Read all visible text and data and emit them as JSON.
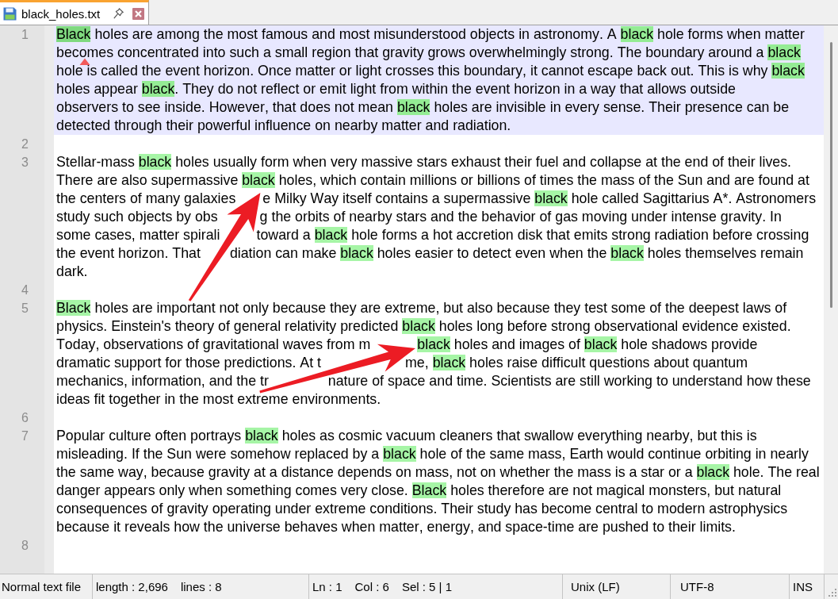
{
  "tab": {
    "title": "black_holes.txt",
    "selected": true
  },
  "editor": {
    "lines": [
      {
        "number": "1",
        "current": true,
        "rows": [
          {
            "segments": [
              {
                "text": "Black",
                "highlighted": true,
                "selected": true
              },
              {
                "text": " holes are among the most famous and most misunderstood objects in astronomy. A ",
                "highlighted": false,
                "selected": false
              },
              {
                "text": "black",
                "highlighted": true,
                "selected": false
              },
              {
                "text": " hole forms when matter",
                "highlighted": false,
                "selected": false
              }
            ]
          },
          {
            "segments": [
              {
                "text": "becomes concentrated into such a small region that gravity grows overwhelmingly strong. The boundary around a ",
                "highlighted": false,
                "selected": false
              },
              {
                "text": "black",
                "highlighted": true,
                "selected": false
              }
            ]
          },
          {
            "segments": [
              {
                "text": "hole is called the event horizon. Once matter or light crosses this boundary, it cannot escape back out. This is why ",
                "highlighted": false,
                "selected": false
              },
              {
                "text": "black",
                "highlighted": true,
                "selected": false
              }
            ]
          },
          {
            "segments": [
              {
                "text": "holes appear ",
                "highlighted": false,
                "selected": false
              },
              {
                "text": "black",
                "highlighted": true,
                "selected": false
              },
              {
                "text": ". They do not reflect or emit light from within the event horizon in a way that allows outside",
                "highlighted": false,
                "selected": false
              }
            ]
          },
          {
            "segments": [
              {
                "text": "observers to see inside. However, that does not mean ",
                "highlighted": false,
                "selected": false
              },
              {
                "text": "black",
                "highlighted": true,
                "selected": false
              },
              {
                "text": " holes are invisible in every sense. Their presence can be",
                "highlighted": false,
                "selected": false
              }
            ]
          },
          {
            "segments": [
              {
                "text": "detected through their powerful influence on nearby matter and radiation.",
                "highlighted": false,
                "selected": false
              }
            ]
          }
        ]
      },
      {
        "number": "2",
        "current": false
      },
      {
        "number": "3",
        "current": false,
        "rows": [
          {
            "segments": [
              {
                "text": "Stellar-mass ",
                "highlighted": false,
                "selected": false
              },
              {
                "text": "black",
                "highlighted": true,
                "selected": false
              },
              {
                "text": " holes usually form when very massive stars exhaust their fuel and collapse at the end of their lives.",
                "highlighted": false,
                "selected": false
              }
            ]
          },
          {
            "segments": [
              {
                "text": "There are also supermassive ",
                "highlighted": false,
                "selected": false
              },
              {
                "text": "black",
                "highlighted": true,
                "selected": false
              },
              {
                "text": " holes, which contain millions or billions of times the mass of the Sun and are found at",
                "highlighted": false,
                "selected": false
              }
            ]
          },
          {
            "segments": [
              {
                "text": "the centers of many galaxies",
                "highlighted": false,
                "selected": false
              },
              {
                "text": "e Milky Way itself contains a supermassive ",
                "highlighted": false,
                "selected": false
              },
              {
                "text": "black",
                "highlighted": true,
                "selected": false
              },
              {
                "text": " hole called Sagittarius A*. Astronomers",
                "highlighted": false,
                "selected": false
              }
            ]
          },
          {
            "segments": [
              {
                "text": "study such objects by obs",
                "highlighted": false,
                "selected": false
              },
              {
                "text": "g the orbits of nearby stars and the behavior of gas moving under intense gravity. In",
                "highlighted": false,
                "selected": false
              }
            ]
          },
          {
            "segments": [
              {
                "text": "some cases, matter spirali",
                "highlighted": false,
                "selected": false
              },
              {
                "text": "toward a ",
                "highlighted": false,
                "selected": false
              },
              {
                "text": "black",
                "highlighted": true,
                "selected": false
              },
              {
                "text": " hole forms a hot accretion disk that emits strong radiation before crossing",
                "highlighted": false,
                "selected": false
              }
            ]
          },
          {
            "segments": [
              {
                "text": "the event horizon. That",
                "highlighted": false,
                "selected": false
              },
              {
                "text": "diation can make ",
                "highlighted": false,
                "selected": false
              },
              {
                "text": "black",
                "highlighted": true,
                "selected": false
              },
              {
                "text": " holes easier to detect even when the ",
                "highlighted": false,
                "selected": false
              },
              {
                "text": "black",
                "highlighted": true,
                "selected": false
              },
              {
                "text": " holes themselves remain",
                "highlighted": false,
                "selected": false
              }
            ]
          },
          {
            "segments": [
              {
                "text": "dark.",
                "highlighted": false,
                "selected": false
              }
            ]
          }
        ]
      },
      {
        "number": "4",
        "current": false
      },
      {
        "number": "5",
        "current": false,
        "rows": [
          {
            "segments": [
              {
                "text": "Black",
                "highlighted": true,
                "selected": false
              },
              {
                "text": " holes are important not only because they are extreme, but also because they test some of the deepest laws of",
                "highlighted": false,
                "selected": false
              }
            ]
          },
          {
            "segments": [
              {
                "text": "physics. Einstein's theory of general relativity predicted ",
                "highlighted": false,
                "selected": false
              },
              {
                "text": "black",
                "highlighted": true,
                "selected": false
              },
              {
                "text": " holes long before strong observational evidence existed.",
                "highlighted": false,
                "selected": false
              }
            ]
          },
          {
            "segments": [
              {
                "text": "Today, observations of gravitational waves from m",
                "highlighted": false,
                "selected": false
              },
              {
                "text": "black",
                "highlighted": true,
                "selected": false
              },
              {
                "text": " holes and images of ",
                "highlighted": false,
                "selected": false
              },
              {
                "text": "black",
                "highlighted": true,
                "selected": false
              },
              {
                "text": " hole shadows provide",
                "highlighted": false,
                "selected": false
              }
            ]
          },
          {
            "segments": [
              {
                "text": "dramatic support for those predictions. At t",
                "highlighted": false,
                "selected": false
              },
              {
                "text": "me, ",
                "highlighted": false,
                "selected": false
              },
              {
                "text": "black",
                "highlighted": true,
                "selected": false
              },
              {
                "text": " holes raise difficult questions about quantum",
                "highlighted": false,
                "selected": false
              }
            ]
          },
          {
            "segments": [
              {
                "text": "mechanics, information, and the tr",
                "highlighted": false,
                "selected": false
              },
              {
                "text": "nature of space and time. Scientists are still working to understand how these",
                "highlighted": false,
                "selected": false
              }
            ]
          },
          {
            "segments": [
              {
                "text": "ideas fit together in the most extreme environments.",
                "highlighted": false,
                "selected": false
              }
            ]
          }
        ]
      },
      {
        "number": "6",
        "current": false
      },
      {
        "number": "7",
        "current": false,
        "rows": [
          {
            "segments": [
              {
                "text": "Popular culture often portrays ",
                "highlighted": false,
                "selected": false
              },
              {
                "text": "black",
                "highlighted": true,
                "selected": false
              },
              {
                "text": " holes as cosmic vacuum cleaners that swallow everything nearby, but this is",
                "highlighted": false,
                "selected": false
              }
            ]
          },
          {
            "segments": [
              {
                "text": "misleading. If the Sun were somehow replaced by a ",
                "highlighted": false,
                "selected": false
              },
              {
                "text": "black",
                "highlighted": true,
                "selected": false
              },
              {
                "text": " hole of the same mass, Earth would continue orbiting in nearly",
                "highlighted": false,
                "selected": false
              }
            ]
          },
          {
            "segments": [
              {
                "text": "the same way, because gravity at a distance depends on mass, not on whether the mass is a star or a ",
                "highlighted": false,
                "selected": false
              },
              {
                "text": "black",
                "highlighted": true,
                "selected": false
              },
              {
                "text": " hole. The real",
                "highlighted": false,
                "selected": false
              }
            ]
          },
          {
            "segments": [
              {
                "text": "danger appears only when something comes very close. ",
                "highlighted": false,
                "selected": false
              },
              {
                "text": "Black",
                "highlighted": true,
                "selected": false
              },
              {
                "text": " holes therefore are not magical monsters, but natural",
                "highlighted": false,
                "selected": false
              }
            ]
          },
          {
            "segments": [
              {
                "text": "consequences of gravity operating under extreme conditions. Their study has become central to modern astrophysics",
                "highlighted": false,
                "selected": false
              }
            ]
          },
          {
            "segments": [
              {
                "text": "because it reveals how the universe behaves when matter, energy, and space-time are pushed to their limits.",
                "highlighted": false,
                "selected": false
              }
            ]
          }
        ]
      },
      {
        "number": "8",
        "current": false
      }
    ]
  },
  "status_bar": {
    "sections": [
      {
        "texts": [
          "Normal text file"
        ]
      },
      {
        "texts": [
          "length : 2,696",
          "lines : 8"
        ]
      },
      {
        "texts": [
          "Ln : 1",
          "Col : 6",
          "Sel : 5 | 1"
        ]
      },
      {
        "texts": [
          "Unix (LF)"
        ]
      },
      {
        "texts": [
          "UTF-8"
        ]
      },
      {
        "texts": [
          "INS"
        ]
      }
    ]
  }
}
